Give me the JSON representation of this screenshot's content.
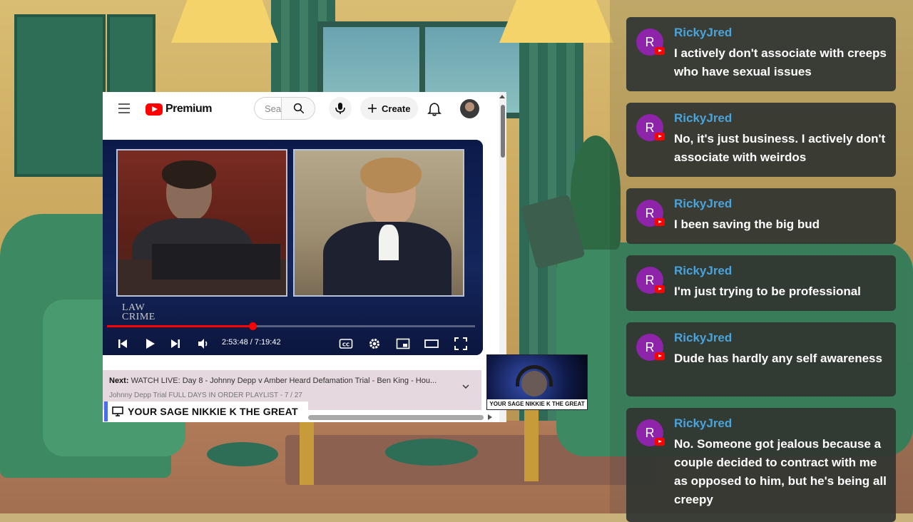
{
  "youtube": {
    "logo_text": "Premium",
    "search_placeholder": "Sea",
    "create_label": "Create",
    "video": {
      "watermark_line1": "LAW",
      "watermark_line2": "CRIME",
      "time_display": "2:53:48 / 7:19:42",
      "progress_fraction": 0.395
    },
    "next": {
      "label": "Next:",
      "title": "WATCH LIVE: Day 8 - Johnny Depp v Amber Heard Defamation Trial - Ben King - Hou...",
      "playlist": "Johnny Depp Trial FULL DAYS IN ORDER PLAYLIST - 7 / 27"
    }
  },
  "banner": {
    "text": "YOUR SAGE NIKKIE K THE GREAT"
  },
  "webcam": {
    "label": "YOUR SAGE NIKKIE K THE GREAT"
  },
  "chat": {
    "messages": [
      {
        "avatar": "R",
        "user": "RickyJred",
        "text": "I actively don't associate with creeps who have sexual issues"
      },
      {
        "avatar": "R",
        "user": "RickyJred",
        "text": "No, it's just business. I actively don't associate with weirdos"
      },
      {
        "avatar": "R",
        "user": "RickyJred",
        "text": "I been saving the big bud"
      },
      {
        "avatar": "R",
        "user": "RickyJred",
        "text": "I'm just trying to be professional"
      },
      {
        "avatar": "R",
        "user": "RickyJred",
        "text": "Dude has hardly any self awareness"
      },
      {
        "avatar": "R",
        "user": "RickyJred",
        "text": "No. Someone got jealous because a couple decided to contract with me as opposed to him, but he's being all creepy"
      }
    ]
  },
  "colors": {
    "yt_red": "#ff0000",
    "chat_username": "#4aa3d9",
    "chat_avatar": "#8e24aa",
    "banner_accent": "#4a6cf0"
  }
}
